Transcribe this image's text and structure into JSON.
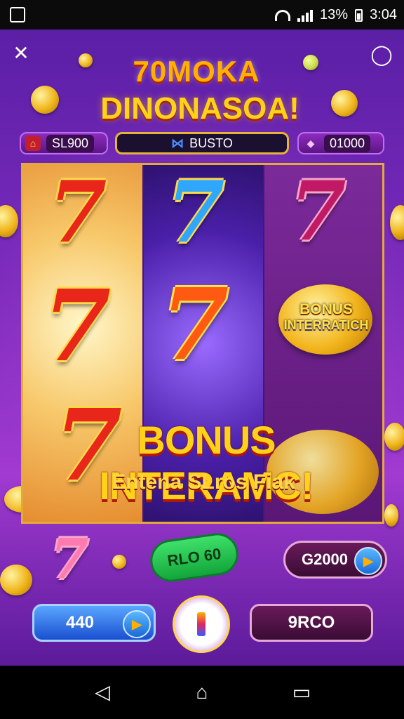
{
  "status_bar": {
    "battery_text": "13%",
    "time": "3:04"
  },
  "header": {
    "title_line1": "70MOKA",
    "title_line2": "DINONASOA!"
  },
  "top_bar": {
    "left_value": "SL900",
    "middle_label": "BUSTO",
    "right_value": "01000"
  },
  "reels": {
    "symbols": [
      "7",
      "7",
      "7",
      "7",
      "7",
      "7"
    ],
    "bonus_badge_line1": "BONUS",
    "bonus_badge_line2": "INTERRATICH"
  },
  "banner": {
    "line1": "BONUS INTERAMC!",
    "line2": "Entena SLros Fiak"
  },
  "controls": {
    "green_button": "RLO 60",
    "value_button": "G2000",
    "blue_button": "440",
    "dark_button": "9RCO"
  },
  "colors": {
    "background": "#7c2bbd",
    "gold": "#ffd21a",
    "frame": "#e3a93a"
  },
  "icons": [
    "close-icon",
    "settings-icon",
    "home-icon",
    "diamond-icon",
    "play-arrow-icon",
    "back-icon",
    "recents-icon"
  ]
}
